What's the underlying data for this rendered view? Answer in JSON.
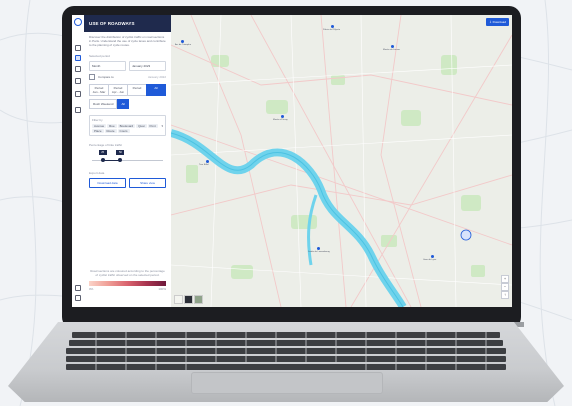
{
  "app": {
    "title": "USE OF ROADWAYS",
    "description": "Discover the distribution of cyclist traffic on road sections in Paris. Understand the use of cycle lanes and contribute to the planning of cycle routes.",
    "accent_color": "#1f5ad8",
    "header_color": "#1f2a4d"
  },
  "controls": {
    "period_label": "Selected period",
    "month_value": "Month",
    "year_value": "January 2023",
    "compare_label": "Compare to",
    "compare_value": "January 2022",
    "tabs": [
      {
        "label": "Period",
        "sub": "Jan - Mar",
        "active": false
      },
      {
        "label": "Period",
        "sub": "Apr - Jun",
        "active": false
      },
      {
        "label": "Period",
        "sub": "",
        "active": false
      },
      {
        "label": "All",
        "sub": "",
        "active": true
      }
    ],
    "mode_options": [
      {
        "label": "Rush Weekend",
        "active": false
      },
      {
        "label": "All",
        "active": true
      }
    ],
    "filter_label": "Filter by",
    "filter_chips": [
      "Avenue",
      "Rue",
      "Boulevard",
      "Quai",
      "Pont",
      "Place",
      "Route",
      "Cours"
    ],
    "range_label": "Percentage of bike traffic",
    "range_min": "25",
    "range_max": "50",
    "export_label": "Export data",
    "export_buttons": [
      "Download data",
      "Share view"
    ],
    "legend_note": "Road sections are coloured according to the percentage of cyclist traffic observed on the selected period.",
    "legend_min": "0%",
    "legend_max": "100%"
  },
  "map": {
    "download_label": "Download",
    "labels": [
      "Arc de Triomphe",
      "Palais de l'Elysée",
      "Musée du Louvre",
      "Tour Eiffel",
      "Musée d'Orsay",
      "Jardin du Luxembourg",
      "Gare de Lyon"
    ]
  },
  "icons": [
    "logo-icon",
    "layers-icon",
    "chart-icon",
    "user-icon",
    "pin-icon",
    "settings-icon",
    "zoom-in-icon",
    "zoom-out-icon",
    "compass-icon"
  ]
}
